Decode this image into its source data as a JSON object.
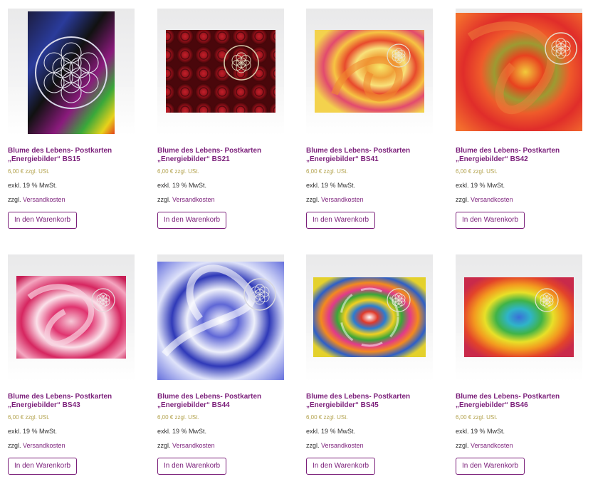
{
  "products": [
    {
      "title1": "Blume des Lebens- Postkarten",
      "title2": "„Energiebilder“ BS15",
      "price": "6,00 €",
      "price_note": "zzgl. USt.",
      "tax": "exkl. 19 % MwSt.",
      "ship_prefix": "zzgl.",
      "ship_link": "Versandkosten",
      "button": "In den Warenkorb"
    },
    {
      "title1": "Blume des Lebens- Postkarten",
      "title2": "„Energiebilder“ BS21",
      "price": "6,00 €",
      "price_note": "zzgl. USt.",
      "tax": "exkl. 19 % MwSt.",
      "ship_prefix": "zzgl.",
      "ship_link": "Versandkosten",
      "button": "In den Warenkorb"
    },
    {
      "title1": "Blume des Lebens- Postkarten",
      "title2": "„Energiebilder“ BS41",
      "price": "6,00 €",
      "price_note": "zzgl. USt.",
      "tax": "exkl. 19 % MwSt.",
      "ship_prefix": "zzgl.",
      "ship_link": "Versandkosten",
      "button": "In den Warenkorb"
    },
    {
      "title1": "Blume des Lebens- Postkarten",
      "title2": "„Energiebilder“ BS42",
      "price": "6,00 €",
      "price_note": "zzgl. USt.",
      "tax": "exkl. 19 % MwSt.",
      "ship_prefix": "zzgl.",
      "ship_link": "Versandkosten",
      "button": "In den Warenkorb"
    },
    {
      "title1": "Blume des Lebens- Postkarten",
      "title2": "„Energiebilder“ BS43",
      "price": "6,00 €",
      "price_note": "zzgl. USt.",
      "tax": "exkl. 19 % MwSt.",
      "ship_prefix": "zzgl.",
      "ship_link": "Versandkosten",
      "button": "In den Warenkorb"
    },
    {
      "title1": "Blume des Lebens- Postkarten",
      "title2": "„Energiebilder“ BS44",
      "price": "6,00 €",
      "price_note": "zzgl. USt.",
      "tax": "exkl. 19 % MwSt.",
      "ship_prefix": "zzgl.",
      "ship_link": "Versandkosten",
      "button": "In den Warenkorb"
    },
    {
      "title1": "Blume des Lebens- Postkarten",
      "title2": "„Energiebilder“ BS45",
      "price": "6,00 €",
      "price_note": "zzgl. USt.",
      "tax": "exkl. 19 % MwSt.",
      "ship_prefix": "zzgl.",
      "ship_link": "Versandkosten",
      "button": "In den Warenkorb"
    },
    {
      "title1": "Blume des Lebens- Postkarten",
      "title2": "„Energiebilder“ BS46",
      "price": "6,00 €",
      "price_note": "zzgl. USt.",
      "tax": "exkl. 19 % MwSt.",
      "ship_prefix": "zzgl.",
      "ship_link": "Versandkosten",
      "button": "In den Warenkorb"
    }
  ],
  "colors": {
    "accent": "#7b1f7a",
    "price": "#b3a24d",
    "text": "#333333"
  }
}
